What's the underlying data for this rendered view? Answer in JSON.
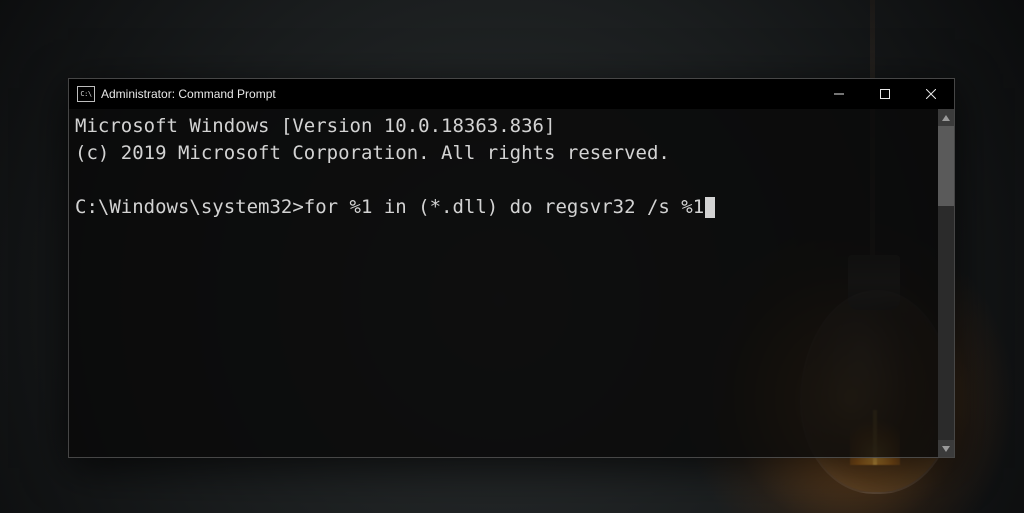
{
  "window": {
    "title": "Administrator: Command Prompt"
  },
  "terminal": {
    "line1": "Microsoft Windows [Version 10.0.18363.836]",
    "line2": "(c) 2019 Microsoft Corporation. All rights reserved.",
    "blank": "",
    "prompt": "C:\\Windows\\system32>",
    "command": "for %1 in (*.dll) do regsvr32 /s %1"
  },
  "colors": {
    "terminal_fg": "#d3d3d3",
    "terminal_bg": "rgba(10,10,10,0.88)",
    "titlebar_bg": "#000000"
  }
}
